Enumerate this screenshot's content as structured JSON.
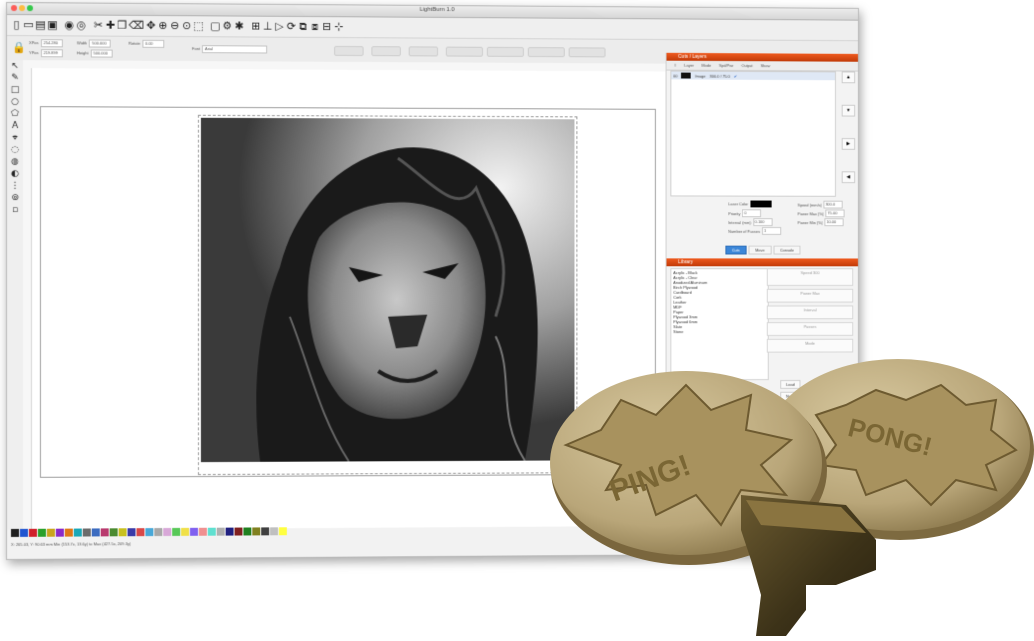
{
  "window": {
    "title": "LightBurn 1.0"
  },
  "toolbar_icons": [
    "new-file-icon",
    "open-file-icon",
    "save-icon",
    "save-as-icon",
    "import-icon",
    "export-icon",
    "cut-icon",
    "move-icon",
    "copy-icon",
    "delete-icon",
    "pan-icon",
    "zoom-in-icon",
    "zoom-out-icon",
    "zoom-fit-icon",
    "frame-icon",
    "monitor-icon",
    "settings-icon",
    "tools-icon",
    "align-icon",
    "distribute-icon",
    "mirror-icon",
    "rotate-icon",
    "group-icon",
    "ungroup-icon",
    "grid-icon",
    "snap-icon"
  ],
  "toolbar2": {
    "xpos_label": "XPos",
    "xpos_value": "254.280",
    "ypos_label": "YPos",
    "ypos_value": "219.899",
    "width_label": "Width",
    "width_value": "500.000",
    "height_label": "Height",
    "height_value": "500.000",
    "rotate_label": "Rotate",
    "rotate_value": "0.00",
    "font_label": "Font",
    "font_value": "Arial"
  },
  "palette_colors": [
    "#1e1e1e",
    "#2055d0",
    "#d0202a",
    "#2aa02a",
    "#c9a51e",
    "#8a2ac8",
    "#e07818",
    "#1aa8b8",
    "#6c6c6c",
    "#3c6cc0",
    "#b83a6e",
    "#4a8a30",
    "#c8c020",
    "#3a3aa8",
    "#d84848",
    "#48a8d8",
    "#a8a8a8",
    "#d8a8d8",
    "#58c858",
    "#f0e048",
    "#8060f0",
    "#f09090",
    "#60e0d0",
    "#b0b0b0",
    "#202080",
    "#802020",
    "#208020",
    "#808020",
    "#404040",
    "#c0c0c0",
    "#ffff40"
  ],
  "status_text": "X: 265.03, Y: 90.63 mm   Min (153.7x, 13.6y) to Max (427.5x, 209.3y)",
  "cuts_panel": {
    "title": "Cuts / Layers",
    "tabs": [
      "#",
      "Layer",
      "Mode",
      "Spd/Pwr",
      "Output",
      "Show"
    ],
    "row": {
      "index": "00",
      "mode": "Image",
      "speed_power": "300.0 / 75.0"
    },
    "props": {
      "laser_label": "Laser Color",
      "priority_label": "Priority",
      "priority_value": "0",
      "interval_label": "Interval (mm)",
      "interval_value": "0.100",
      "speed_label": "Speed (mm/s)",
      "speed_value": "300.0",
      "power_max_label": "Power Max (%)",
      "power_max_value": "75.00",
      "power_min_label": "Power Min (%)",
      "power_min_value": "10.00",
      "speed_mm_label": "Speed (mm/s)",
      "passes_label": "Number of Passes",
      "passes_value": "1"
    },
    "bottom_tabs": [
      "Cuts",
      "Move",
      "Console"
    ]
  },
  "library_panel": {
    "title": "Library",
    "items": [
      "Acrylic - Black",
      "Acrylic - Clear",
      "Anodized Aluminum",
      "Birch Plywood",
      "Cardboard",
      "Cork",
      "Leather",
      "MDF",
      "Paper",
      "Plywood 3mm",
      "Plywood 6mm",
      "Slate",
      "Stone"
    ],
    "right_labels": [
      "Speed 300",
      "Power Max",
      "Interval",
      "Passes",
      "Mode"
    ],
    "load_label": "Load",
    "save_label": "Save",
    "new_label": "New"
  }
}
